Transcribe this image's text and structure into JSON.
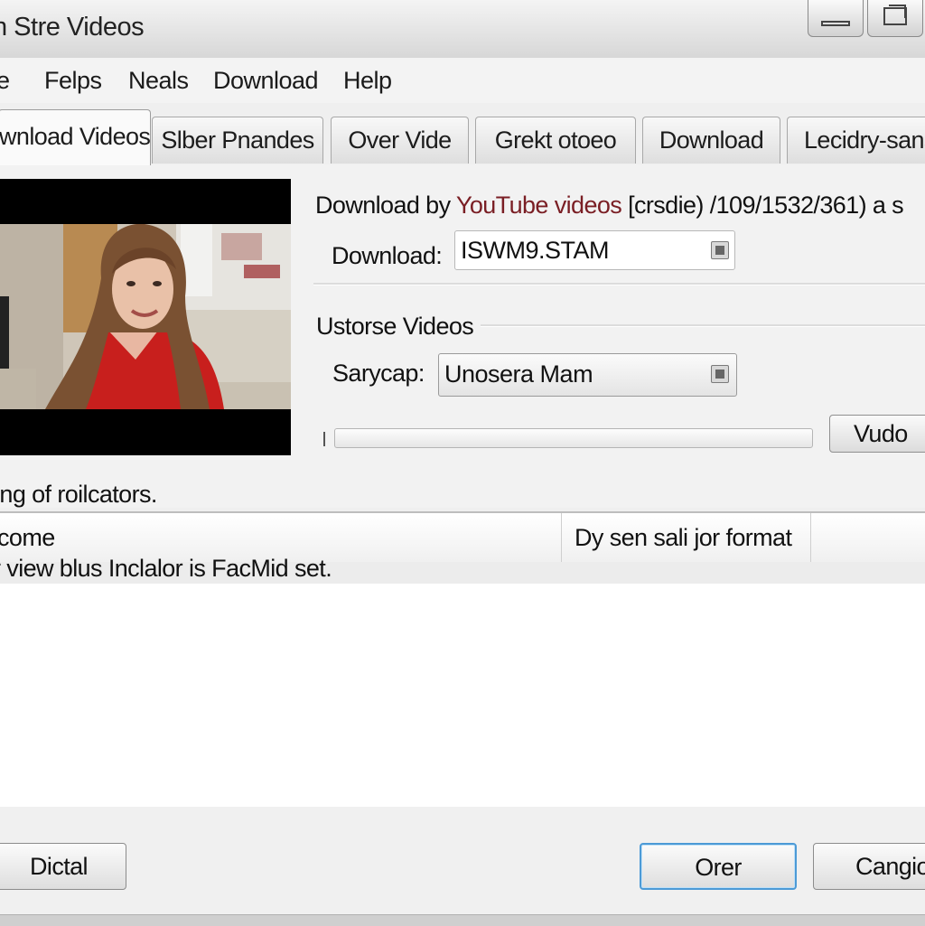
{
  "window": {
    "title": "n Stre Videos"
  },
  "menu": [
    {
      "label": "e"
    },
    {
      "label": "Felps"
    },
    {
      "label": "Neals"
    },
    {
      "label": "Download"
    },
    {
      "label": "Help"
    }
  ],
  "tabs": [
    {
      "label": "wnload Videos",
      "active": true
    },
    {
      "label": "Slber Pnandes"
    },
    {
      "label": "Over Vide"
    },
    {
      "label": "Grekt otoeo"
    },
    {
      "label": "Download"
    },
    {
      "label": "Lecidry-sans"
    }
  ],
  "main": {
    "info_prefix": "Download by ",
    "info_link": "YouTube videos",
    "info_suffix": " [crsdie) /109/1532/361) a s",
    "download_label": "Download:",
    "download_value": "ISWM9.STAM",
    "group_title": "Ustorse Videos",
    "sarycap_label": "Sarycap:",
    "sarycap_value": "Unosera Mam",
    "progress_fraction": 0.0,
    "video_button": "Vudo",
    "status": "ing of roilcators."
  },
  "list": {
    "columns": [
      "come",
      "Dy sen sali jor format"
    ],
    "rows": [
      {
        "text": "r view blus Inclalor is FacMid set."
      }
    ]
  },
  "buttons": {
    "left": "Dictal",
    "ok": "Orer",
    "cancel": "Cangio"
  },
  "colors": {
    "accent_border": "#4c9ad6",
    "link_text": "#7a1e24"
  }
}
